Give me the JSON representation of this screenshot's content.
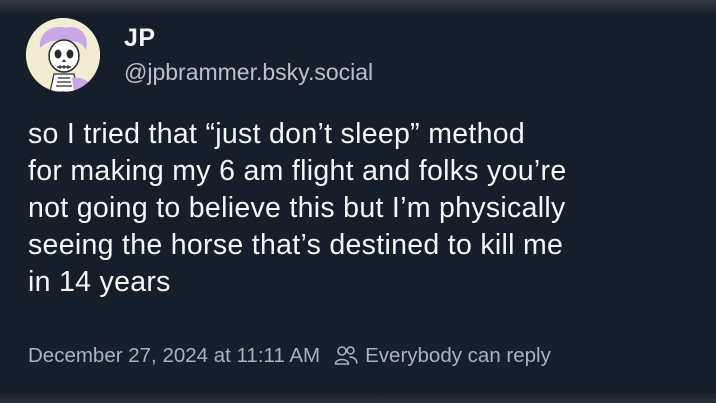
{
  "post": {
    "author": {
      "display_name": "JP",
      "handle": "@jpbrammer.bsky.social",
      "avatar_icon": "skeleton-avatar-icon"
    },
    "text_lines": [
      "so I tried that “just don’t sleep” method",
      "for making my 6 am flight and folks you’re",
      "not going to believe this but I’m physically",
      "seeing the horse that’s destined to kill me",
      "in 14 years"
    ],
    "timestamp": "December 27, 2024 at 11:11 AM",
    "reply_setting": {
      "icon": "people-icon",
      "label": "Everybody can reply"
    }
  },
  "colors": {
    "background": "#161e2a",
    "primary_text": "#f4f5f7",
    "secondary_text": "#a9b2be",
    "avatar_bg": "#f3ecd5",
    "avatar_accent": "#c9a6e6"
  }
}
